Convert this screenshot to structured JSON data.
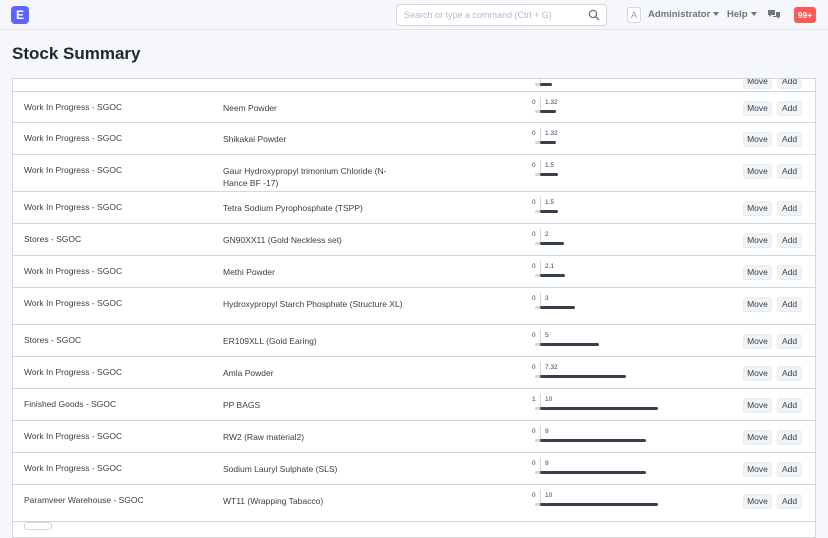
{
  "app": {
    "logo_letter": "E"
  },
  "search": {
    "placeholder": "Search or type a command (Ctrl + G)"
  },
  "user": {
    "avatar_letter": "A",
    "name": "Administrator"
  },
  "help": {
    "label": "Help"
  },
  "notifications": {
    "count": "99+"
  },
  "page": {
    "title": "Stock Summary"
  },
  "actions": {
    "move_label": "Move",
    "add_label": "Add"
  },
  "rows": [
    {
      "warehouse": "Work In Progress - SGOC",
      "item": "Neem Powder",
      "min": "0",
      "qty": "1.32",
      "fraction": 0.132
    },
    {
      "warehouse": "Work In Progress - SGOC",
      "item": "Shikakai Powder",
      "min": "0",
      "qty": "1.32",
      "fraction": 0.132
    },
    {
      "warehouse": "Work In Progress - SGOC",
      "item": "Gaur Hydroxypropyl trimonium Chloride (N-Hance BF -17)",
      "min": "0",
      "qty": "1.5",
      "fraction": 0.15
    },
    {
      "warehouse": "Work In Progress - SGOC",
      "item": "Tetra Sodium Pyrophosphate (TSPP)",
      "min": "0",
      "qty": "1.5",
      "fraction": 0.15
    },
    {
      "warehouse": "Stores - SGOC",
      "item": "GN90XX11 (Gold Neckless set)",
      "min": "0",
      "qty": "2",
      "fraction": 0.2
    },
    {
      "warehouse": "Work In Progress - SGOC",
      "item": "Methi Powder",
      "min": "0",
      "qty": "2.1",
      "fraction": 0.21
    },
    {
      "warehouse": "Work In Progress - SGOC",
      "item": "Hydroxypropyl Starch Phosphate (Structure XL)",
      "min": "0",
      "qty": "3",
      "fraction": 0.3
    },
    {
      "warehouse": "Stores - SGOC",
      "item": "ER109XLL (Gold Earing)",
      "min": "0",
      "qty": "5",
      "fraction": 0.5
    },
    {
      "warehouse": "Work In Progress - SGOC",
      "item": "Amla Powder",
      "min": "0",
      "qty": "7.32",
      "fraction": 0.732
    },
    {
      "warehouse": "Finished Goods - SGOC",
      "item": "PP BAGS",
      "min": "1",
      "qty": "10",
      "fraction": 1.0
    },
    {
      "warehouse": "Work In Progress - SGOC",
      "item": "RW2 (Raw material2)",
      "min": "0",
      "qty": "9",
      "fraction": 0.9
    },
    {
      "warehouse": "Work In Progress - SGOC",
      "item": "Sodium Lauryl Sulphate (SLS)",
      "min": "0",
      "qty": "9",
      "fraction": 0.9
    },
    {
      "warehouse": "Paramveer Warehouse - SGOC",
      "item": "WT11 (Wrapping Tabacco)",
      "min": "0",
      "qty": "10",
      "fraction": 1.0
    }
  ],
  "colors": {
    "accent": "#5e64ff",
    "badge": "#ff5858",
    "bar": "#36414c"
  }
}
